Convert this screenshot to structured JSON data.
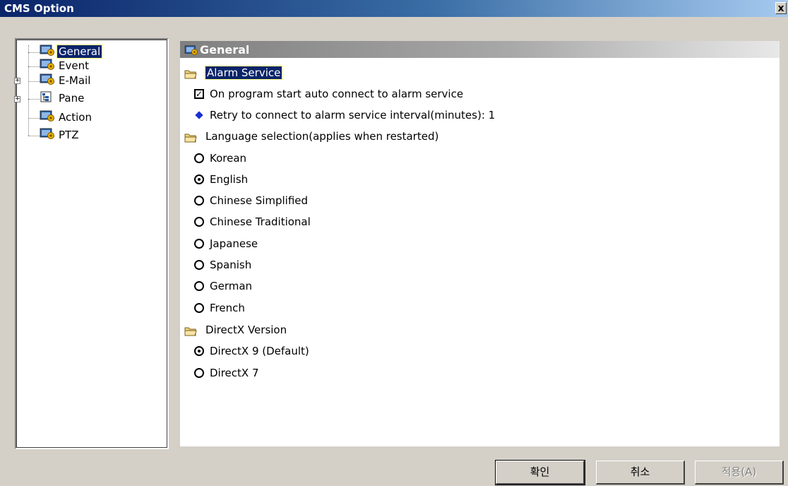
{
  "window": {
    "title": "CMS Option",
    "close_label": "x"
  },
  "tree": {
    "items": [
      {
        "label": "General",
        "selected": true,
        "icon": "settings-gear-icon"
      },
      {
        "label": "Event",
        "icon": "settings-gear-icon"
      },
      {
        "label": "E-Mail",
        "expandable": true,
        "icon": "settings-gear-icon"
      },
      {
        "label": "Pane",
        "expandable": true,
        "icon": "tree-pane-icon"
      },
      {
        "label": "Action",
        "icon": "settings-gear-icon"
      },
      {
        "label": "PTZ",
        "icon": "settings-gear-icon"
      }
    ]
  },
  "panel": {
    "title": "General",
    "alarm": {
      "heading": "Alarm Service",
      "auto_connect": {
        "label": "On program start auto connect to alarm service",
        "checked": true
      },
      "retry": {
        "label": "Retry to connect to alarm service interval(minutes): 1"
      }
    },
    "language": {
      "heading": "Language selection(applies when restarted)",
      "options": [
        "Korean",
        "English",
        "Chinese Simplified",
        "Chinese Traditional",
        "Japanese",
        "Spanish",
        "German",
        "French"
      ],
      "selected": "English"
    },
    "directx": {
      "heading": "DirectX Version",
      "options": [
        "DirectX 9 (Default)",
        "DirectX 7"
      ],
      "selected": "DirectX 9 (Default)"
    }
  },
  "buttons": {
    "ok": "확인",
    "cancel": "취소",
    "apply": "적용(A)"
  },
  "colors": {
    "selection": "#0a246a",
    "title_bar_start": "#0a246a",
    "diamond": "#1a2fd0"
  }
}
